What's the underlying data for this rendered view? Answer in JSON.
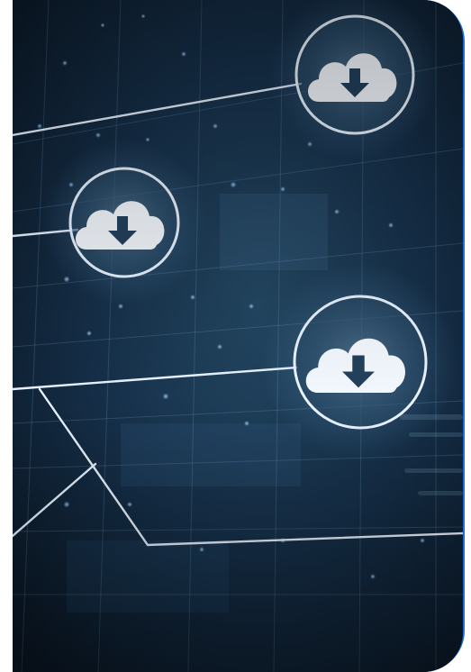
{
  "image": {
    "subject": "cloud-download-network",
    "accent_color": "#1d6fd6",
    "background_color": "#0b1a2c",
    "icons": [
      "cloud-download-icon",
      "cloud-download-icon",
      "cloud-download-icon"
    ]
  }
}
